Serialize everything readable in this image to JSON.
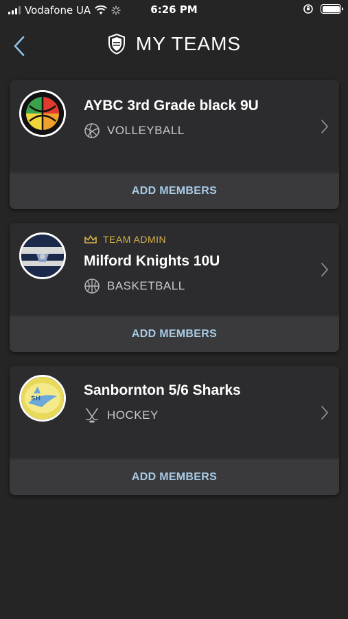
{
  "status_bar": {
    "carrier": "Vodafone UA",
    "time": "6:26 PM"
  },
  "header": {
    "title": "MY TEAMS"
  },
  "teams": [
    {
      "name": "AYBC 3rd Grade black 9U",
      "sport": "VOLLEYBALL",
      "add_label": "ADD MEMBERS"
    },
    {
      "role": "TEAM ADMIN",
      "name": "Milford Knights 10U",
      "sport": "BASKETBALL",
      "add_label": "ADD MEMBERS"
    },
    {
      "name": "Sanbornton 5/6 Sharks",
      "sport": "HOCKEY",
      "add_label": "ADD MEMBERS"
    }
  ],
  "colors": {
    "background": "#252526",
    "card": "#2f2f31",
    "accent": "#a8cbe6",
    "admin": "#d6b24a"
  }
}
